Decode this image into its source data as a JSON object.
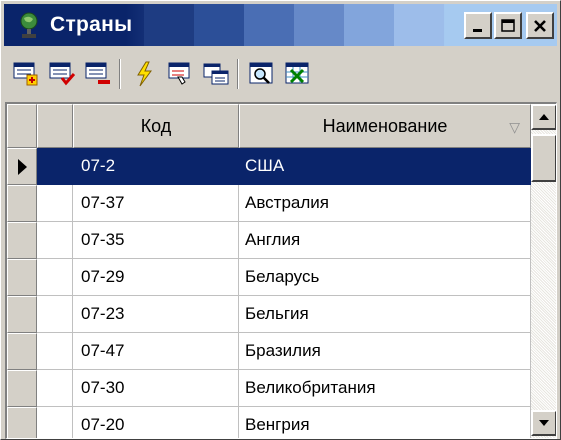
{
  "window": {
    "title": "Страны",
    "icon": "globe-stand-icon",
    "controls": {
      "minimize": "minimize-icon",
      "maximize": "maximize-icon",
      "close": "close-icon"
    }
  },
  "toolbar": {
    "buttons": [
      {
        "name": "add-record-button",
        "icon": "add-record-icon"
      },
      {
        "name": "edit-record-button",
        "icon": "edit-record-icon"
      },
      {
        "name": "delete-record-button",
        "icon": "delete-record-icon"
      },
      {
        "name": "refresh-button",
        "icon": "lightning-icon"
      },
      {
        "name": "filter-button",
        "icon": "filter-icon"
      },
      {
        "name": "copy-button",
        "icon": "copy-icon"
      },
      {
        "name": "find-button",
        "icon": "search-icon"
      },
      {
        "name": "export-button",
        "icon": "excel-export-icon"
      }
    ]
  },
  "grid": {
    "columns": {
      "code": "Код",
      "name": "Наименование"
    },
    "rows": [
      {
        "code": "07-2",
        "name": "США",
        "selected": true
      },
      {
        "code": "07-37",
        "name": "Австралия"
      },
      {
        "code": "07-35",
        "name": "Англия"
      },
      {
        "code": "07-29",
        "name": "Беларусь"
      },
      {
        "code": "07-23",
        "name": "Бельгия"
      },
      {
        "code": "07-47",
        "name": "Бразилия"
      },
      {
        "code": "07-30",
        "name": "Великобритания"
      },
      {
        "code": "07-20",
        "name": "Венгрия"
      }
    ]
  },
  "colors": {
    "selection": "#0a246a",
    "face": "#d4d0c8",
    "title_start": "#0a246a",
    "title_end": "#a6caf0"
  }
}
